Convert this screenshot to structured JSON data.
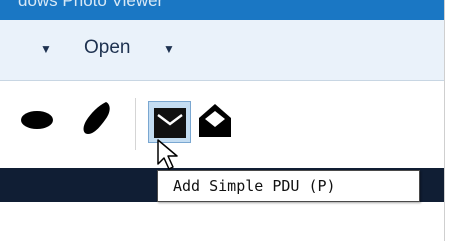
{
  "window": {
    "title": "dows Photo Viewer"
  },
  "menu": {
    "arrow_left": "▼",
    "open_label": "Open",
    "arrow_right": "▼"
  },
  "toolbar": {
    "icons": [
      "ellipse-shape-icon",
      "freeform-shape-icon",
      "add-simple-pdu-icon",
      "open-envelope-icon"
    ]
  },
  "tooltip": {
    "text": "Add Simple PDU (P)"
  },
  "colors": {
    "titlebar": "#1a77c4",
    "menubar": "#eaf2fa",
    "darkbar": "#101e34",
    "highlight": "#c4ddf2"
  }
}
